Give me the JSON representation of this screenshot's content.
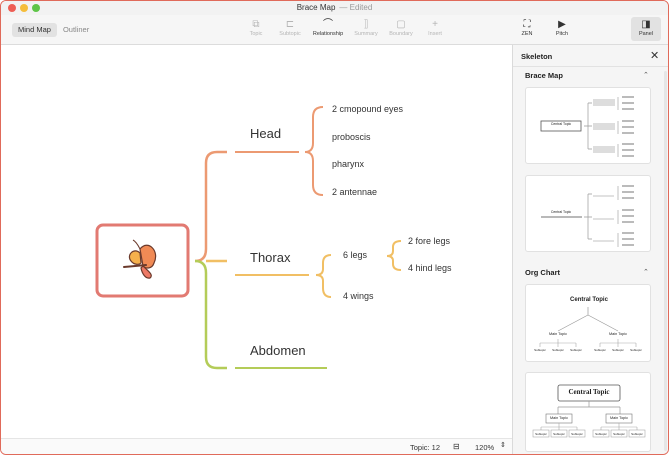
{
  "window": {
    "title": "Brace Map",
    "status": "— Edited"
  },
  "toolbar": {
    "tabs": [
      {
        "label": "Mind Map",
        "active": true
      },
      {
        "label": "Outliner",
        "active": false
      }
    ],
    "tools": [
      {
        "label": "Topic",
        "icon": "topic-icon",
        "glyph": "⧉",
        "enabled": false
      },
      {
        "label": "Subtopic",
        "icon": "subtopic-icon",
        "glyph": "⊏",
        "enabled": false
      },
      {
        "label": "Relationship",
        "icon": "relationship-icon",
        "glyph": "⌒",
        "enabled": true
      },
      {
        "label": "Summary",
        "icon": "summary-icon",
        "glyph": "⟧",
        "enabled": false
      },
      {
        "label": "Boundary",
        "icon": "boundary-icon",
        "glyph": "▢",
        "enabled": false
      },
      {
        "label": "Insert",
        "icon": "insert-icon",
        "glyph": "+",
        "enabled": false
      }
    ],
    "right_tools": [
      {
        "label": "ZEN",
        "icon": "zen-icon",
        "glyph": "⛶"
      },
      {
        "label": "Pitch",
        "icon": "pitch-icon",
        "glyph": "▶"
      },
      {
        "label": "Panel",
        "icon": "panel-icon",
        "glyph": "◨"
      }
    ]
  },
  "map": {
    "central_icon": "butterfly-icon",
    "colors": {
      "head": "#ec9a72",
      "thorax": "#f1bf64",
      "abdomen": "#b4cc58",
      "central_border": "#e27a72"
    },
    "branches": [
      {
        "label": "Head",
        "children": [
          "2 cmopound eyes",
          "proboscis",
          "pharynx",
          "2 antennae"
        ]
      },
      {
        "label": "Thorax",
        "children": [
          "6 legs",
          "4 wings"
        ],
        "grandchildren": [
          "2 fore legs",
          "4 hind legs"
        ]
      },
      {
        "label": "Abdomen",
        "children": []
      }
    ]
  },
  "status": {
    "topic_count": "Topic: 12",
    "zoom": "120%"
  },
  "panel": {
    "title": "Skeleton",
    "sections": [
      {
        "label": "Brace Map"
      },
      {
        "label": "Org Chart"
      }
    ],
    "templates": {
      "central_topic": "Central Topic",
      "main_topic": "Main Topic",
      "subtopic": "Subtopic"
    }
  }
}
